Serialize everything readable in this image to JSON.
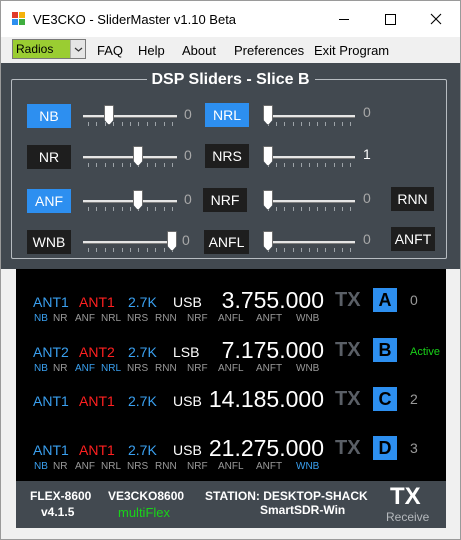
{
  "window": {
    "title": "VE3CKO - SliderMaster    v1.10 Beta",
    "icon": "app-icon"
  },
  "menu": {
    "radios_value": "Radios",
    "items": [
      "FAQ",
      "Help",
      "About",
      "Preferences",
      "Exit Program"
    ]
  },
  "dsp": {
    "title": "DSP Sliders - Slice B",
    "sliders": [
      {
        "label": "NB",
        "on": true,
        "value": "0",
        "level": 0.25
      },
      {
        "label": "NR",
        "on": false,
        "value": "0",
        "level": 0.6
      },
      {
        "label": "ANF",
        "on": true,
        "value": "0",
        "level": 0.6
      },
      {
        "label": "WNB",
        "on": false,
        "value": "0",
        "level": 1.0
      },
      {
        "label": "NRL",
        "on": true,
        "value": "0",
        "level": 0.0
      },
      {
        "label": "NRS",
        "on": false,
        "value": "1",
        "level": 0.0
      },
      {
        "label": "NRF",
        "on": false,
        "value": "0",
        "level": 0.0
      },
      {
        "label": "ANFL",
        "on": false,
        "value": "0",
        "level": 0.0
      }
    ],
    "extra_buttons": [
      {
        "label": "RNN"
      },
      {
        "label": "ANFT"
      }
    ]
  },
  "slices": [
    {
      "ant_rx": "ANT1",
      "ant_tx": "ANT1",
      "bandwidth": "2.7K",
      "mode": "USB",
      "frequency": "3.755.000",
      "tx": "TX",
      "letter": "A",
      "status": "0",
      "flags": [
        "NB",
        "NR",
        "ANF",
        "NRL",
        "NRS",
        "RNN",
        "NRF",
        "ANFL",
        "ANFT",
        "WNB"
      ],
      "flags_on": [
        "NB"
      ]
    },
    {
      "ant_rx": "ANT2",
      "ant_tx": "ANT2",
      "bandwidth": "2.7K",
      "mode": "LSB",
      "frequency": "7.175.000",
      "tx": "TX",
      "letter": "B",
      "status": "Active",
      "flags": [
        "NB",
        "NR",
        "ANF",
        "NRL",
        "NRS",
        "RNN",
        "NRF",
        "ANFL",
        "ANFT",
        "WNB"
      ],
      "flags_on": [
        "NB",
        "ANF",
        "NRL"
      ]
    },
    {
      "ant_rx": "ANT1",
      "ant_tx": "ANT1",
      "bandwidth": "2.7K",
      "mode": "USB",
      "frequency": "14.185.000",
      "tx": "TX",
      "letter": "C",
      "status": "2",
      "flags": [],
      "flags_on": []
    },
    {
      "ant_rx": "ANT1",
      "ant_tx": "ANT1",
      "bandwidth": "2.7K",
      "mode": "USB",
      "frequency": "21.275.000",
      "tx": "TX",
      "letter": "D",
      "status": "3",
      "flags": [
        "NB",
        "NR",
        "ANF",
        "NRL",
        "NRS",
        "RNN",
        "NRF",
        "ANFL",
        "ANFT",
        "WNB"
      ],
      "flags_on": [
        "NB",
        "WNB"
      ]
    }
  ],
  "footer": {
    "radio_model": "FLEX-8600",
    "radio_version": "v4.1.5",
    "callsign": "VE3CKO8600",
    "client": "multiFlex",
    "station": "STATION: DESKTOP-SHACK",
    "program": "SmartSDR-Win",
    "tx_label": "TX",
    "rx_label": "Receive"
  },
  "colors": {
    "accent": "#2d8ff0",
    "ant_tx_red": "#ff2020",
    "active_green": "#19d319",
    "panel_bg": "#424950",
    "radios_bg": "#9acd32"
  }
}
